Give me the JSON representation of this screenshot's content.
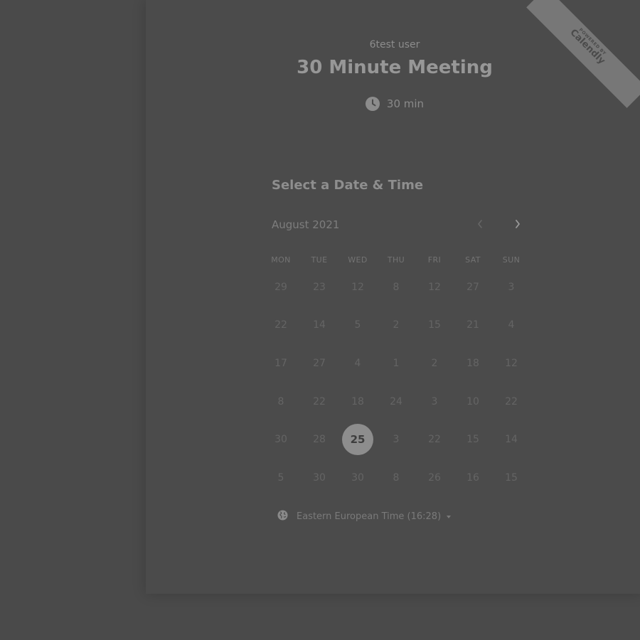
{
  "header": {
    "host_name": "6test user",
    "event_title": "30 Minute Meeting",
    "duration": "30 min",
    "duration_icon": "clock-icon"
  },
  "calendar": {
    "section_title": "Select a Date & Time",
    "month_label": "August 2021",
    "prev_icon": "chevron-left-icon",
    "next_icon": "chevron-right-icon",
    "weekdays": [
      "MON",
      "TUE",
      "WED",
      "THU",
      "FRI",
      "SAT",
      "SUN"
    ],
    "days": [
      [
        "29",
        "23",
        "12",
        "8",
        "12",
        "27",
        "3"
      ],
      [
        "22",
        "14",
        "5",
        "2",
        "15",
        "21",
        "4"
      ],
      [
        "17",
        "27",
        "4",
        "1",
        "2",
        "18",
        "12"
      ],
      [
        "8",
        "22",
        "18",
        "24",
        "3",
        "10",
        "22"
      ],
      [
        "30",
        "28",
        "25",
        "3",
        "22",
        "15",
        "14"
      ],
      [
        "5",
        "30",
        "30",
        "8",
        "26",
        "16",
        "15"
      ]
    ],
    "selected_day": "25"
  },
  "timezone": {
    "icon": "globe-icon",
    "label": "Eastern European Time (16:28)",
    "dropdown_icon": "caret-down-icon"
  },
  "badge": {
    "line1": "POWERED BY",
    "line2": "Calendly"
  }
}
